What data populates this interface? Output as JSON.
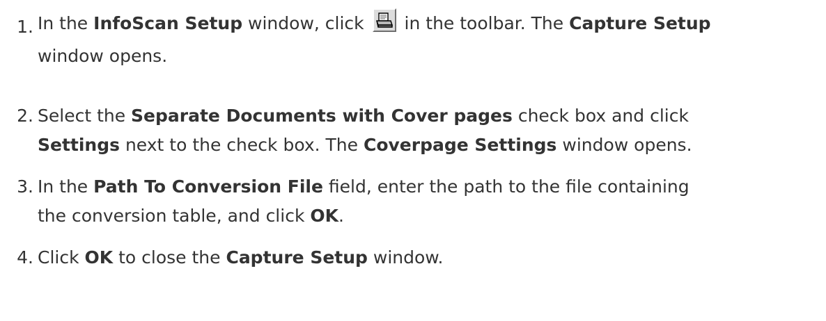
{
  "steps": [
    {
      "number": "1.",
      "icon": "scanner-settings-icon",
      "t1": "In the ",
      "b1": "InfoScan Setup",
      "t2": " window, click ",
      "t3": " in the toolbar. The ",
      "b2": "Capture Setup",
      "t4": "window opens."
    },
    {
      "number": "2.",
      "t1": "Select the ",
      "b1": "Separate Documents with Cover pages",
      "t2": " check box and click",
      "b2": "Settings",
      "t3": " next to the check box. The ",
      "b3": "Coverpage Settings",
      "t4": " window opens."
    },
    {
      "number": "3.",
      "t1": "In the ",
      "b1": "Path To Conversion File",
      "t2": " field, enter the path to the file containing",
      "t3": "the conversion table, and click ",
      "b2": "OK",
      "t4": "."
    },
    {
      "number": "4.",
      "t1": "Click ",
      "b1": "OK",
      "t2": " to close the ",
      "b2": "Capture Setup",
      "t3": " window."
    }
  ]
}
